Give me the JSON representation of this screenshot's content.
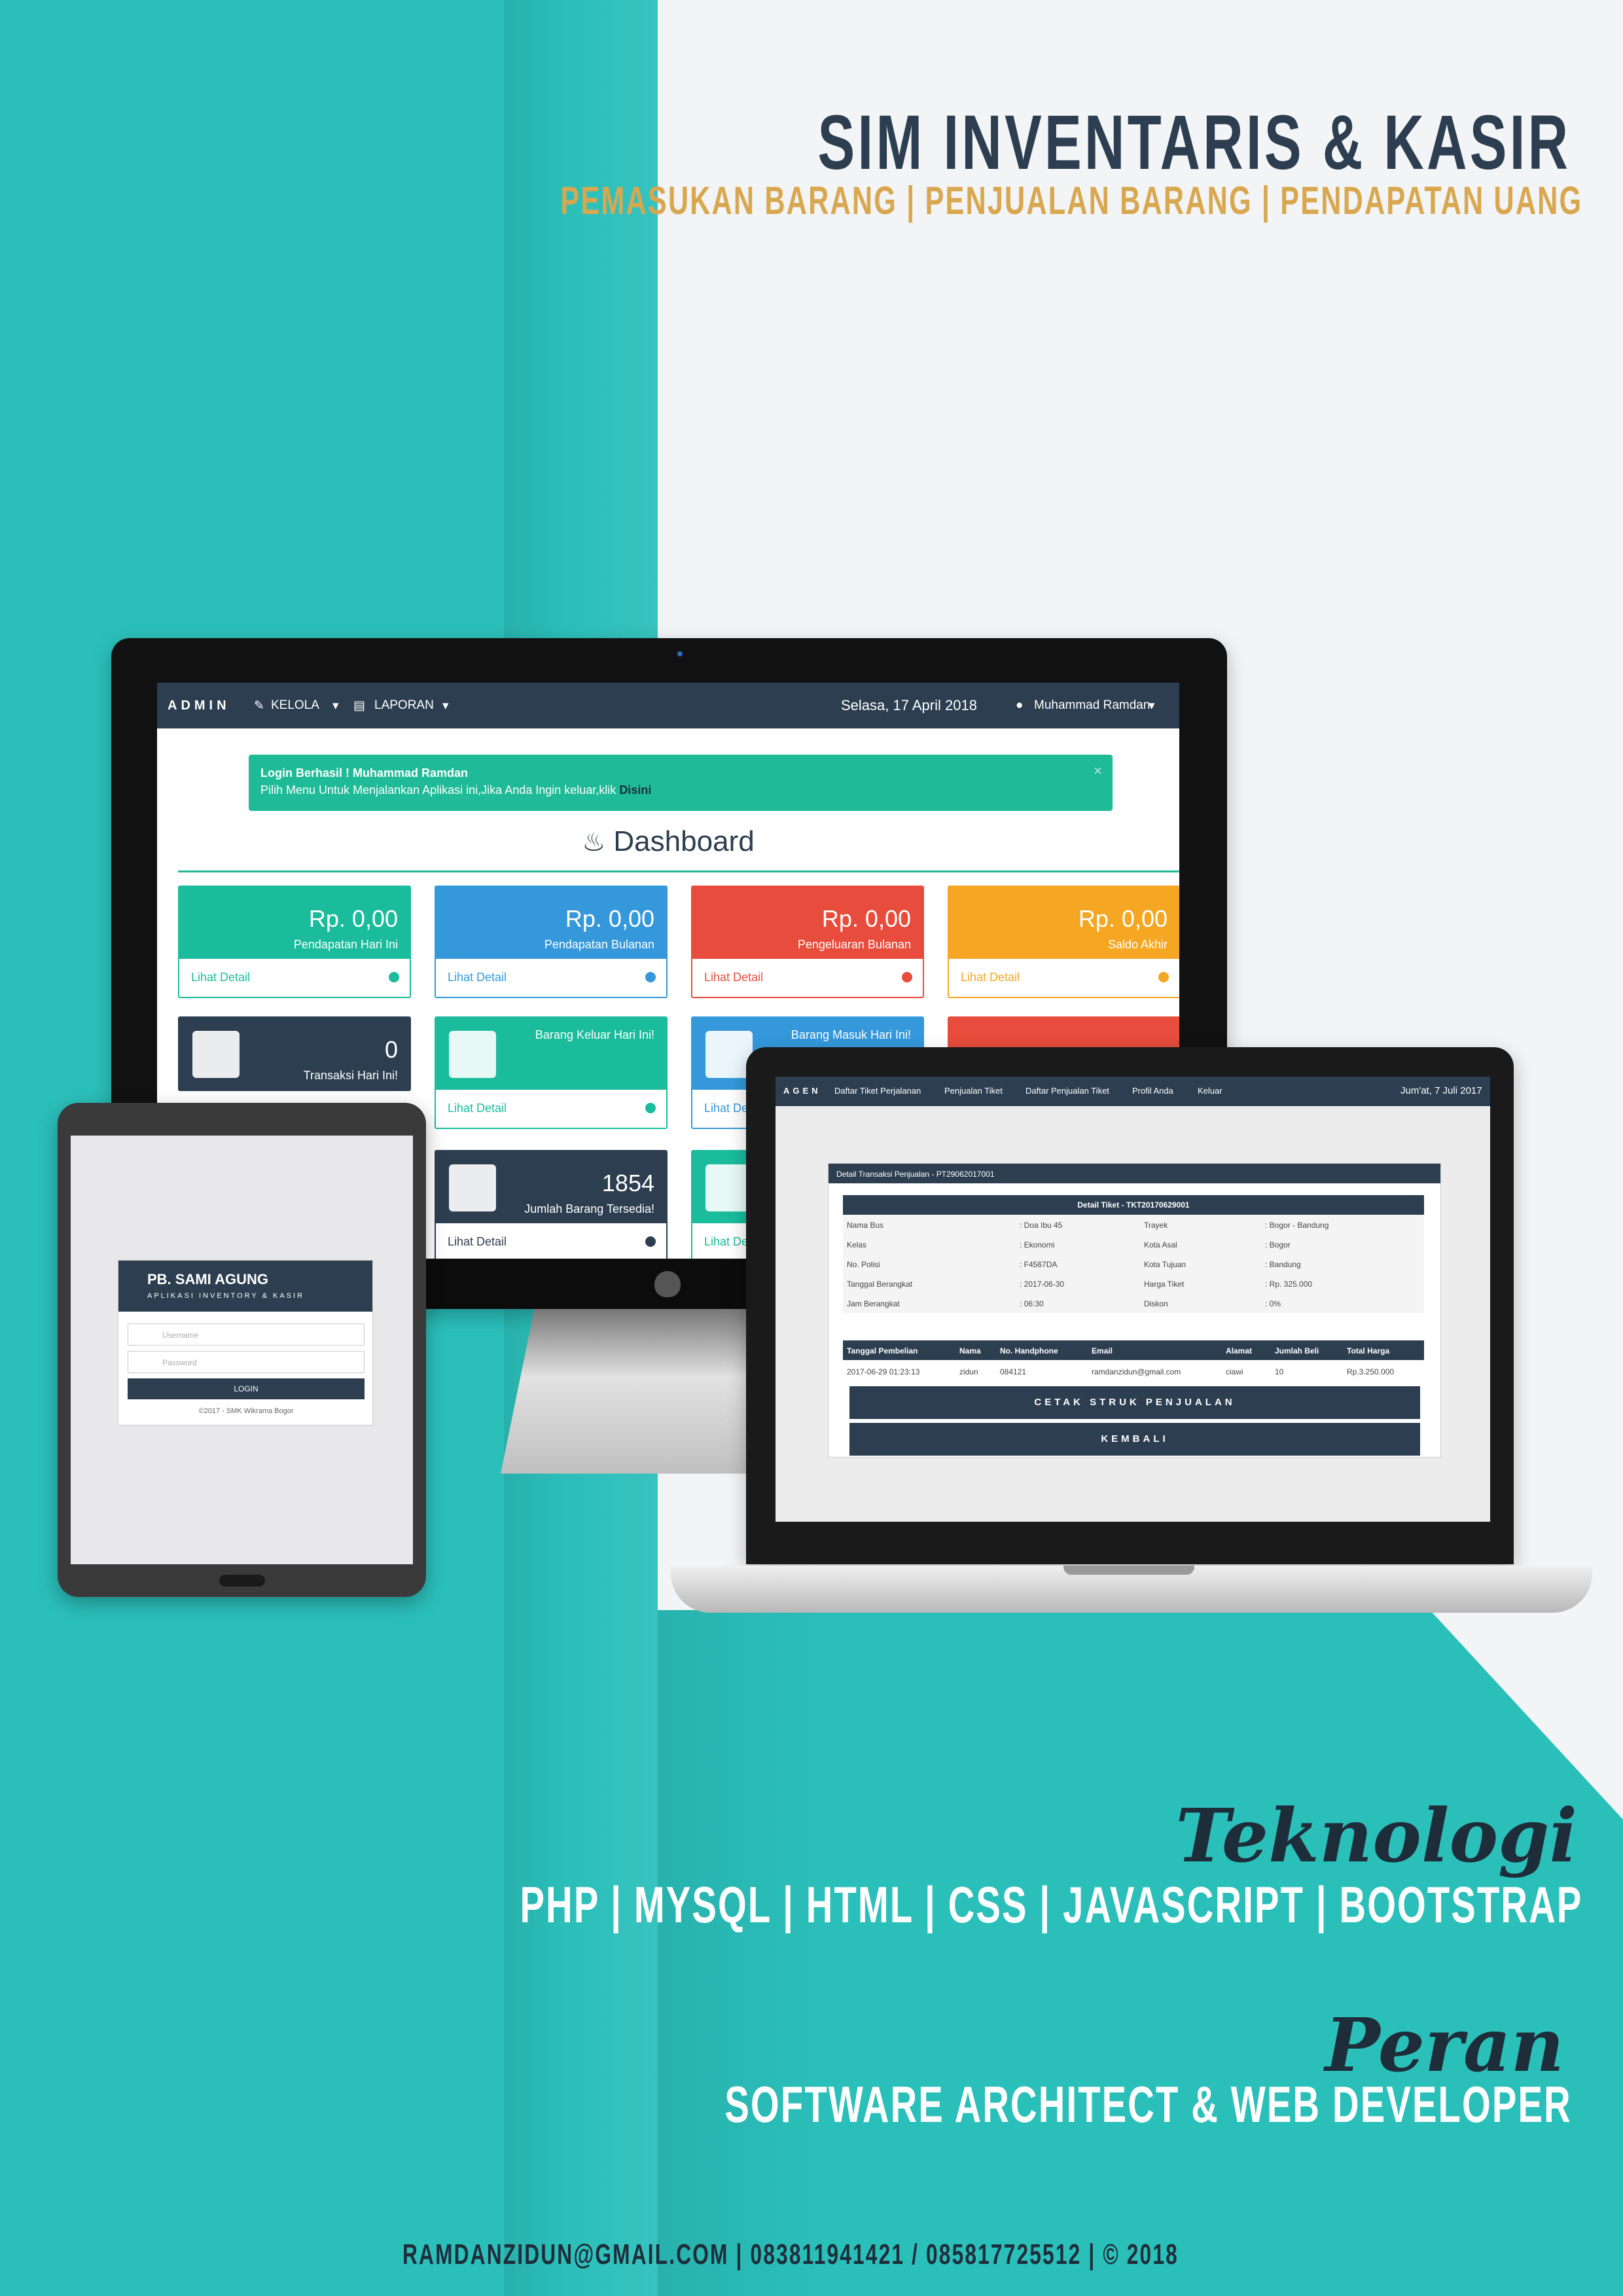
{
  "poster": {
    "title": "SIM INVENTARIS & KASIR",
    "subtitle": "PEMASUKAN BARANG | PENJUALAN BARANG | PENDAPATAN UANG",
    "tech_heading": "Teknologi",
    "tech_list": "PHP | MYSQL | HTML | CSS | JAVASCRIPT | BOOTSTRAP",
    "role_heading": "Peran",
    "role": "SOFTWARE ARCHITECT & WEB DEVELOPER",
    "footer": "RAMDANZIDUN@GMAIL.COM | 083811941421 / 085817725512 | © 2018",
    "colors": {
      "teal": "#2bbfba",
      "navy": "#2c3e50",
      "gold": "#d8a74f"
    }
  },
  "admin": {
    "brand": "ADMIN",
    "menu_kelola": "KELOLA",
    "menu_laporan": "LAPORAN",
    "date": "Selasa, 17 April 2018",
    "user": "Muhammad Ramdan",
    "alert_title": "Login Berhasil ! Muhammad Ramdan",
    "alert_text": "Pilih Menu Untuk Menjalankan Aplikasi ini,Jika Anda Ingin keluar,klik",
    "alert_link": "Disini",
    "alert_close": "×",
    "dashboard_title": "Dashboard",
    "cards": [
      {
        "amount": "Rp. 0,00",
        "caption": "Pendapatan Hari Ini",
        "link": "Lihat Detail",
        "color": "#1abc9c"
      },
      {
        "amount": "Rp. 0,00",
        "caption": "Pendapatan Bulanan",
        "link": "Lihat Detail",
        "color": "#3498db"
      },
      {
        "amount": "Rp. 0,00",
        "caption": "Pengeluaran Bulanan",
        "link": "Lihat Detail",
        "color": "#e74c3c"
      },
      {
        "amount": "Rp. 0,00",
        "caption": "Saldo Akhir",
        "link": "Lihat Detail",
        "color": "#f5a623"
      }
    ],
    "cards2": [
      {
        "amount": "0",
        "caption": "Transaksi Hari Ini!",
        "link": "",
        "color": "#2c3e50"
      },
      {
        "amount": "",
        "caption": "Barang Keluar Hari Ini!",
        "link": "Lihat Detail",
        "color": "#1abc9c"
      },
      {
        "amount": "",
        "caption": "Barang Masuk Hari Ini!",
        "link": "Lihat De",
        "color": "#3498db"
      },
      {
        "amount": "1854",
        "caption": "Jumlah Barang Tersedia!",
        "link": "Lihat Detail",
        "color": "#2c3e50"
      },
      {
        "amount": "",
        "caption": "",
        "link": "Lihat De",
        "color": "#1abc9c"
      }
    ]
  },
  "tablet": {
    "brand": "PB. SAMI AGUNG",
    "tagline": "APLIKASI INVENTORY & KASIR",
    "username_placeholder": "Username",
    "password_placeholder": "Password",
    "login_label": "LOGIN",
    "footer": "©2017 - SMK Wikrama Bogor"
  },
  "laptop": {
    "brand": "AGEN",
    "nav": [
      "Daftar Tiket Perjalanan",
      "Penjualan Tiket",
      "Daftar Penjualan Tiket",
      "Profil Anda",
      "Keluar"
    ],
    "date": "Jum'at, 7 Juli 2017",
    "panel_title": "Detail Transaksi Penjualan - PT29062017001",
    "ticket_title": "Detail Tiket - TKT20170629001",
    "details": [
      {
        "k1": "Nama Bus",
        "v1": ": Doa Ibu 45",
        "k2": "Trayek",
        "v2": ": Bogor - Bandung"
      },
      {
        "k1": "Kelas",
        "v1": ": Ekonomi",
        "k2": "Kota Asal",
        "v2": ": Bogor"
      },
      {
        "k1": "No. Polisi",
        "v1": ": F4567DA",
        "k2": "Kota Tujuan",
        "v2": ": Bandung"
      },
      {
        "k1": "Tanggal Berangkat",
        "v1": ": 2017-06-30",
        "k2": "Harga Tiket",
        "v2": ": Rp. 325.000"
      },
      {
        "k1": "Jam Berangkat",
        "v1": ": 06:30",
        "k2": "Diskon",
        "v2": ": 0%"
      }
    ],
    "columns": [
      "Tanggal Pembelian",
      "Nama",
      "No. Handphone",
      "Email",
      "Alamat",
      "Jumlah Beli",
      "Total Harga"
    ],
    "row": [
      "2017-06-29 01:23:13",
      "zidun",
      "084121",
      "ramdanzidun@gmail.com",
      "ciawi",
      "10",
      "Rp.3.250.000"
    ],
    "print_label": "CETAK STRUK PENJUALAN",
    "back_label": "KEMBALI"
  }
}
